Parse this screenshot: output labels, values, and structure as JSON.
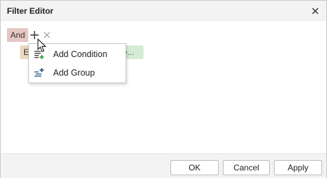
{
  "window": {
    "title": "Filter Editor",
    "close_icon": "close-icon"
  },
  "filter": {
    "group_operator": "And",
    "condition_field_fragment": "E",
    "condition_value_fragment": "e..."
  },
  "context_menu": {
    "items": [
      {
        "label": "Add Condition",
        "icon": "add-condition-icon"
      },
      {
        "label": "Add Group",
        "icon": "add-group-icon"
      }
    ]
  },
  "footer": {
    "ok_label": "OK",
    "cancel_label": "Cancel",
    "apply_label": "Apply"
  },
  "colors": {
    "accent_green": "#2e9a2e",
    "accent_blue": "#2a5a8a",
    "operator_bg": "#e6c7c3",
    "field_bg": "#ead9bd",
    "value_bg": "#d6ebd6"
  }
}
